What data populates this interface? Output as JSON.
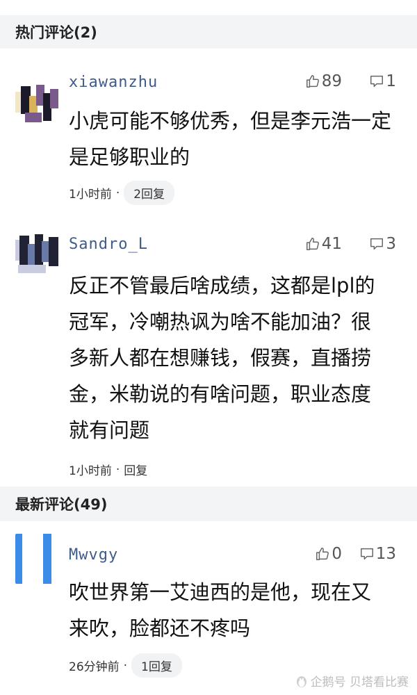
{
  "hot_section": {
    "title": "热门评论(2)"
  },
  "new_section": {
    "title": "最新评论(49)"
  },
  "comments": [
    {
      "username": "xiawanzhu",
      "likes": "89",
      "replies": "1",
      "text": "小虎可能不够优秀，但是李元浩一定是足够职业的",
      "time": "1小时前",
      "reply_link": "2回复"
    },
    {
      "username": "Sandro_L",
      "likes": "41",
      "replies": "3",
      "text": "反正不管最后啥成绩，这都是lpl的冠军，冷嘲热讽为啥不能加油？很多新人都在想赚钱，假赛，直播捞金，米勒说的有啥问题，职业态度就有问题",
      "time": "1小时前",
      "reply_link": "回复"
    },
    {
      "username": "Mwvgy",
      "likes": "0",
      "replies": "13",
      "text": "吹世界第一艾迪西的是他，现在又来吹，脸都还不疼吗",
      "time": "26分钟前",
      "reply_link": "1回复"
    }
  ],
  "watermark": {
    "text": "企鹅号 贝塔看比赛",
    "icon": "penguin-icon"
  },
  "colors": {
    "username": "#3f5b8c",
    "section_bg": "#f3f4f6",
    "pill_bg": "#f1f2f4",
    "avatar1": [
      "#1a1a2a",
      "#7a5a8a",
      "#d8b35a",
      "#f2e6c8"
    ],
    "avatar2": [
      "#222235",
      "#6a7aa8",
      "#c9cce0",
      "#f0f0f5"
    ],
    "avatar3": [
      "#3a8ce8",
      "#ffffff"
    ]
  }
}
